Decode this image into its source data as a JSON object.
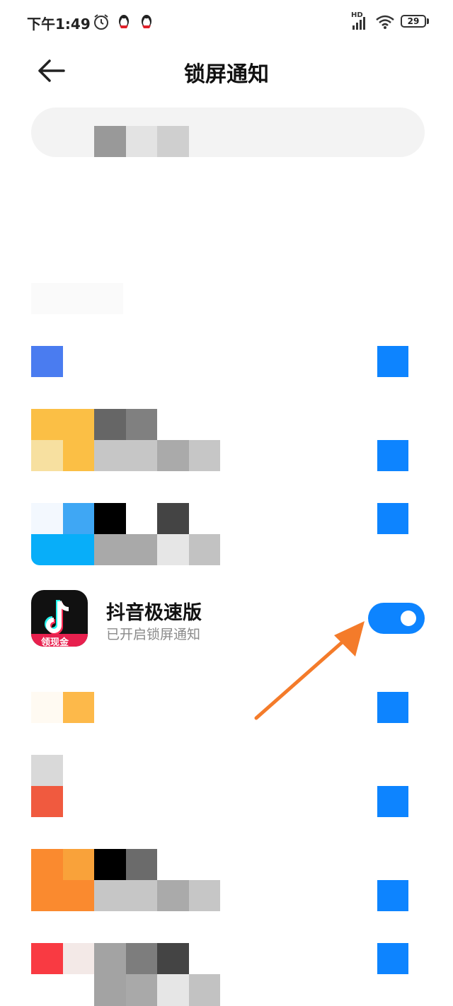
{
  "status_bar": {
    "time": "下午1:49",
    "network": "HD",
    "battery": "29"
  },
  "header": {
    "title": "锁屏通知"
  },
  "featured_app": {
    "name": "抖音极速版",
    "status": "已开启锁屏通知",
    "icon_badge": "领现金",
    "toggle_on": true
  },
  "colors": {
    "accent": "#0d84ff",
    "annotation_arrow": "#f47b2a"
  }
}
